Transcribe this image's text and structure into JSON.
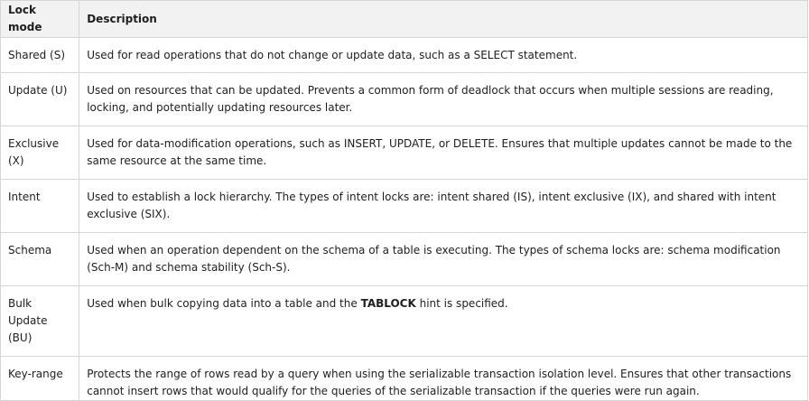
{
  "table": {
    "headers": {
      "mode": "Lock mode",
      "description": "Description"
    },
    "rows": [
      {
        "mode": "Shared (S)",
        "description": "Used for read operations that do not change or update data, such as a SELECT statement."
      },
      {
        "mode": "Update (U)",
        "description": "Used on resources that can be updated. Prevents a common form of deadlock that occurs when multiple sessions are reading, locking, and potentially updating resources later."
      },
      {
        "mode": "Exclusive (X)",
        "description": "Used for data-modification operations, such as INSERT, UPDATE, or DELETE. Ensures that multiple updates cannot be made to the same resource at the same time."
      },
      {
        "mode": "Intent",
        "description": "Used to establish a lock hierarchy. The types of intent locks are: intent shared (IS), intent exclusive (IX), and shared with intent exclusive (SIX)."
      },
      {
        "mode": "Schema",
        "description": "Used when an operation dependent on the schema of a table is executing. The types of schema locks are: schema modification (Sch-M) and schema stability (Sch-S)."
      },
      {
        "mode": "Bulk Update (BU)",
        "description_before": "Used when bulk copying data into a table and the ",
        "description_bold": "TABLOCK",
        "description_after": " hint is specified."
      },
      {
        "mode": "Key-range",
        "description": "Protects the range of rows read by a query when using the serializable transaction isolation level. Ensures that other transactions cannot insert rows that would qualify for the queries of the serializable transaction if the queries were run again."
      }
    ]
  }
}
